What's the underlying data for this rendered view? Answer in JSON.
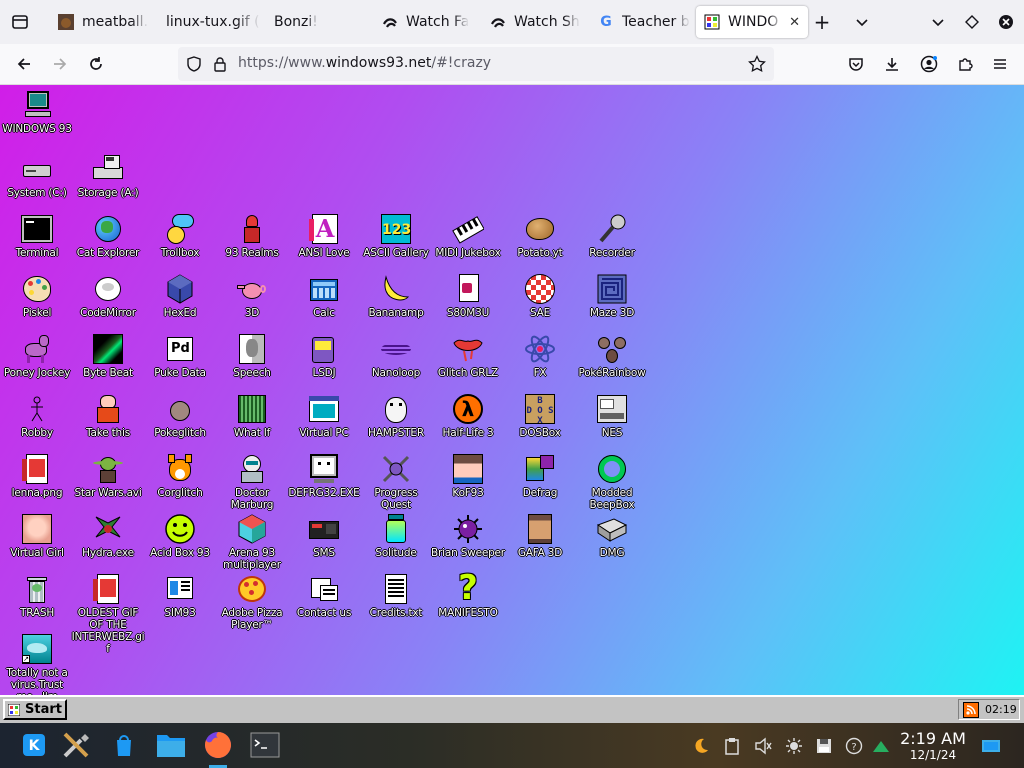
{
  "browser": {
    "tabs": [
      {
        "title": "meatball.",
        "icon": "meatball-favicon"
      },
      {
        "title": "linux-tux.gif (",
        "icon": "image-favicon"
      },
      {
        "title": "Bonzi!",
        "icon": "none"
      },
      {
        "title": "Watch Fa",
        "icon": "stream-favicon"
      },
      {
        "title": "Watch Sh",
        "icon": "stream-favicon"
      },
      {
        "title": "Teacher b",
        "icon": "google-favicon"
      },
      {
        "title": "WINDO",
        "icon": "windows93-favicon",
        "active": true
      }
    ],
    "url_prefix": "https://www.",
    "url_domain": "windows93.net",
    "url_suffix": "/#!crazy"
  },
  "desktop": {
    "icons": [
      {
        "label": "WINDOWS 93",
        "icon": "computer-icon"
      },
      {
        "label": "System (C:)",
        "icon": "drive-icon"
      },
      {
        "label": "Storage (A:)",
        "icon": "floppy-drive-icon"
      },
      {
        "label": "Terminal",
        "icon": "terminal-icon"
      },
      {
        "label": "Cat Explorer",
        "icon": "cat-globe-icon"
      },
      {
        "label": "Trollbox",
        "icon": "chat-bubble-icon"
      },
      {
        "label": "93 Realms",
        "icon": "knight-icon"
      },
      {
        "label": "ANSI Love",
        "icon": "letter-a-icon"
      },
      {
        "label": "ASCII Gallery",
        "icon": "numbers-icon"
      },
      {
        "label": "MIDI Jukebox",
        "icon": "keyboard-icon"
      },
      {
        "label": "Potato.yt",
        "icon": "potato-icon"
      },
      {
        "label": "Recorder",
        "icon": "microphone-icon"
      },
      {
        "label": "Piskel",
        "icon": "paint-palette-icon"
      },
      {
        "label": "CodeMirror",
        "icon": "unicorn-icon"
      },
      {
        "label": "HexEd",
        "icon": "cube-icon"
      },
      {
        "label": "3D",
        "icon": "teapot-icon"
      },
      {
        "label": "Calc",
        "icon": "calculator-icon"
      },
      {
        "label": "Bananamp",
        "icon": "banana-icon"
      },
      {
        "label": "S80M3U",
        "icon": "audio-file-icon"
      },
      {
        "label": "SAE",
        "icon": "checker-ball-icon"
      },
      {
        "label": "Maze 3D",
        "icon": "maze-icon"
      },
      {
        "label": "Poney Jockey",
        "icon": "pony-icon"
      },
      {
        "label": "Byte Beat",
        "icon": "green-wave-icon"
      },
      {
        "label": "Puke Data",
        "icon": "pd-icon"
      },
      {
        "label": "Speech",
        "icon": "face-icon"
      },
      {
        "label": "LSDJ",
        "icon": "gameboy-icon"
      },
      {
        "label": "Nanoloop",
        "icon": "waveform-icon"
      },
      {
        "label": "Glitch GRLZ",
        "icon": "lips-icon"
      },
      {
        "label": "FX",
        "icon": "atom-icon"
      },
      {
        "label": "PokéRainbow",
        "icon": "trio-icon"
      },
      {
        "label": "Robby",
        "icon": "stick-figure-icon"
      },
      {
        "label": "Take this",
        "icon": "monk-icon"
      },
      {
        "label": "Pokeglitch",
        "icon": "glitch-ball-icon"
      },
      {
        "label": "What If",
        "icon": "green-screen-icon"
      },
      {
        "label": "Virtual PC",
        "icon": "window-app-icon"
      },
      {
        "label": "HAMPSTER",
        "icon": "hamster-icon"
      },
      {
        "label": "Half-Life 3",
        "icon": "lambda-icon"
      },
      {
        "label": "DOSBox",
        "icon": "dosbox-icon"
      },
      {
        "label": "NES",
        "icon": "nes-icon"
      },
      {
        "label": "lenna.png",
        "icon": "image-file-icon"
      },
      {
        "label": "Star Wars.avi",
        "icon": "yoda-icon"
      },
      {
        "label": "Corglitch",
        "icon": "corgi-icon"
      },
      {
        "label": "Doctor Marburg",
        "icon": "doctor-icon"
      },
      {
        "label": "DEFRG32.EXE",
        "icon": "monitor-face-icon"
      },
      {
        "label": "Progress Quest",
        "icon": "crossed-swords-icon"
      },
      {
        "label": "KoF93",
        "icon": "fighter-icon"
      },
      {
        "label": "Defrag",
        "icon": "defrag-icon"
      },
      {
        "label": "Modded BeepBox",
        "icon": "green-ring-icon"
      },
      {
        "label": "Virtual Girl",
        "icon": "girl-face-icon"
      },
      {
        "label": "Hydra.exe",
        "icon": "hydra-icon"
      },
      {
        "label": "Acid Box 93",
        "icon": "smiley-icon"
      },
      {
        "label": "Arena 93 multiplayer",
        "icon": "box-3d-icon"
      },
      {
        "label": "SMS",
        "icon": "sms-console-icon"
      },
      {
        "label": "Solitude",
        "icon": "jar-icon"
      },
      {
        "label": "Brian Sweeper",
        "icon": "mine-icon"
      },
      {
        "label": "GAFA 3D",
        "icon": "doom-face-icon"
      },
      {
        "label": "DMG",
        "icon": "dmg-icon"
      },
      {
        "label": "TRASH",
        "icon": "trash-icon"
      },
      {
        "label": "OLDEST GIF OF THE INTERWEBZ.gif",
        "icon": "image-file-icon"
      },
      {
        "label": "SIM93",
        "icon": "sim-icon"
      },
      {
        "label": "Adobe Pizza Player™",
        "icon": "pizza-icon"
      },
      {
        "label": "Contact us",
        "icon": "contact-icon"
      },
      {
        "label": "Credits.txt",
        "icon": "text-file-icon"
      },
      {
        "label": "MANIFESTO",
        "icon": "question-mark-icon"
      },
      {
        "label": "Totally not a virus.Trust me...I'm",
        "icon": "dolphin-icon"
      }
    ]
  },
  "w93taskbar": {
    "start_label": "Start",
    "clock": "02:19"
  },
  "ostaskbar": {
    "time": "2:19 AM",
    "date": "12/1/24"
  }
}
